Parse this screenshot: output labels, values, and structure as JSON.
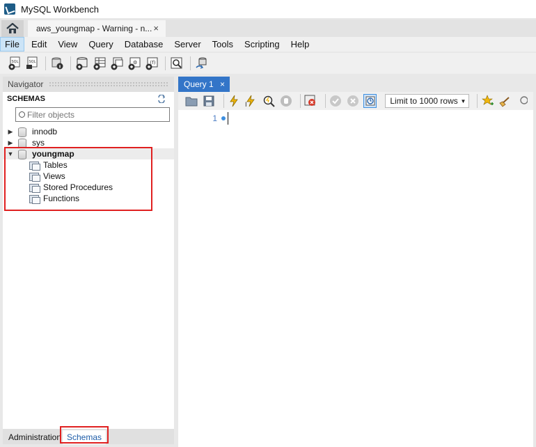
{
  "window": {
    "title": "MySQL Workbench"
  },
  "connection_tab": {
    "label": "aws_youngmap - Warning - n...",
    "close": "×"
  },
  "menu": [
    "File",
    "Edit",
    "View",
    "Query",
    "Database",
    "Server",
    "Tools",
    "Scripting",
    "Help"
  ],
  "navigator": {
    "title": "Navigator",
    "schemas_label": "SCHEMAS",
    "filter_placeholder": "Filter objects"
  },
  "schemas": [
    {
      "name": "innodb",
      "expanded": false
    },
    {
      "name": "sys",
      "expanded": false
    },
    {
      "name": "youngmap",
      "expanded": true,
      "children": [
        "Tables",
        "Views",
        "Stored Procedures",
        "Functions"
      ]
    }
  ],
  "bottom_tabs": [
    "Administration",
    "Schemas"
  ],
  "query_tab": {
    "label": "Query 1",
    "close": "×"
  },
  "editor": {
    "line_number": "1",
    "limit_label": "Limit to 1000 rows"
  },
  "colors": {
    "accent": "#3375c8",
    "highlight": "#e02020"
  }
}
